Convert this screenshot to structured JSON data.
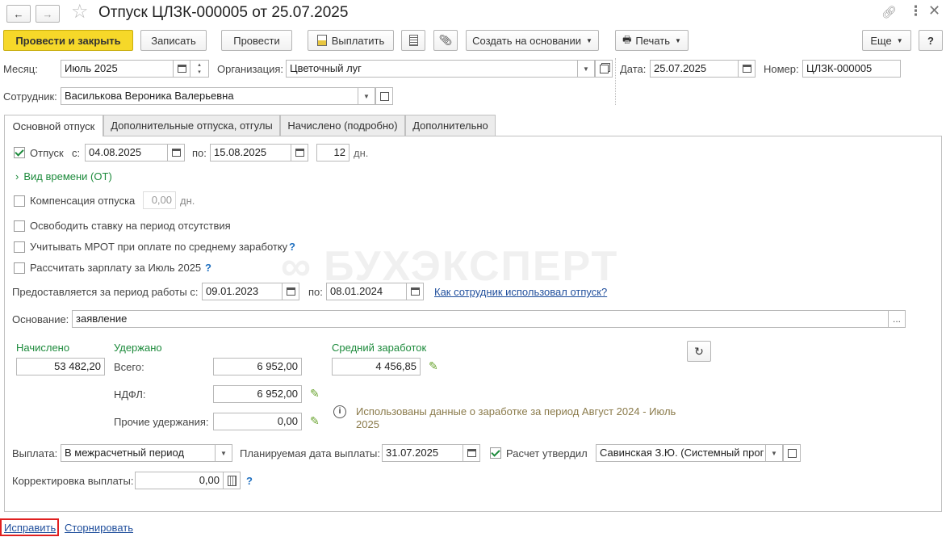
{
  "window": {
    "title": "Отпуск ЦЛЗК-000005 от 25.07.2025"
  },
  "toolbar": {
    "post_close": "Провести и закрыть",
    "save": "Записать",
    "post": "Провести",
    "pay": "Выплатить",
    "create_based": "Создать на основании",
    "print": "Печать",
    "more": "Еще",
    "help": "?"
  },
  "header": {
    "month_label": "Месяц:",
    "month_value": "Июль 2025",
    "org_label": "Организация:",
    "org_value": "Цветочный луг",
    "date_label": "Дата:",
    "date_value": "25.07.2025",
    "number_label": "Номер:",
    "number_value": "ЦЛЗК-000005",
    "employee_label": "Сотрудник:",
    "employee_value": "Василькова Вероника Валерьевна"
  },
  "tabs": [
    {
      "label": "Основной отпуск",
      "active": true
    },
    {
      "label": "Дополнительные отпуска, отгулы",
      "active": false
    },
    {
      "label": "Начислено (подробно)",
      "active": false
    },
    {
      "label": "Дополнительно",
      "active": false
    }
  ],
  "vacation": {
    "checkbox_label": "Отпуск",
    "checked": true,
    "from_label": "с:",
    "from_value": "04.08.2025",
    "to_label": "по:",
    "to_value": "15.08.2025",
    "days_value": "12",
    "days_unit": "дн.",
    "time_type": "Вид времени (ОТ)"
  },
  "options": {
    "compensation_label": "Компенсация отпуска",
    "compensation_value": "0,00",
    "compensation_unit": "дн.",
    "free_rate": "Освободить ставку на период отсутствия",
    "mrot": "Учитывать МРОТ при оплате по среднему заработку",
    "calc_salary": "Рассчитать зарплату за Июль 2025",
    "q": "?"
  },
  "period": {
    "label": "Предоставляется за период работы с:",
    "from_value": "09.01.2023",
    "to_label": "по:",
    "to_value": "08.01.2024",
    "link": "Как сотрудник использовал отпуск?"
  },
  "basis": {
    "label": "Основание:",
    "value": "заявление",
    "btn": "..."
  },
  "totals": {
    "accrued_label": "Начислено",
    "accrued_value": "53 482,20",
    "withheld_label": "Удержано",
    "total_label": "Всего:",
    "total_value": "6 952,00",
    "ndfl_label": "НДФЛ:",
    "ndfl_value": "6 952,00",
    "other_label": "Прочие удержания:",
    "other_value": "0,00",
    "avg_label": "Средний заработок",
    "avg_value": "4 456,85",
    "info_line1": "Использованы данные о заработке за период Август 2024 - Июль",
    "info_line2": "2025"
  },
  "payment": {
    "label": "Выплата:",
    "value": "В межрасчетный период",
    "planned_label": "Планируемая дата выплаты:",
    "planned_value": "31.07.2025",
    "approved_label": "Расчет утвердил",
    "approved_checked": true,
    "approver_value": "Савинская З.Ю. (Системный прог"
  },
  "correction": {
    "label": "Корректировка выплаты:",
    "value": "0,00"
  },
  "footer": {
    "fix": "Исправить",
    "reverse": "Сторнировать"
  },
  "watermark": "БУХЭКСПЕРТ",
  "colors": {
    "primary_button": "#f6d829",
    "green_text": "#1c8a3b",
    "link": "#1f4e9c",
    "highlight_border": "#e02020"
  }
}
